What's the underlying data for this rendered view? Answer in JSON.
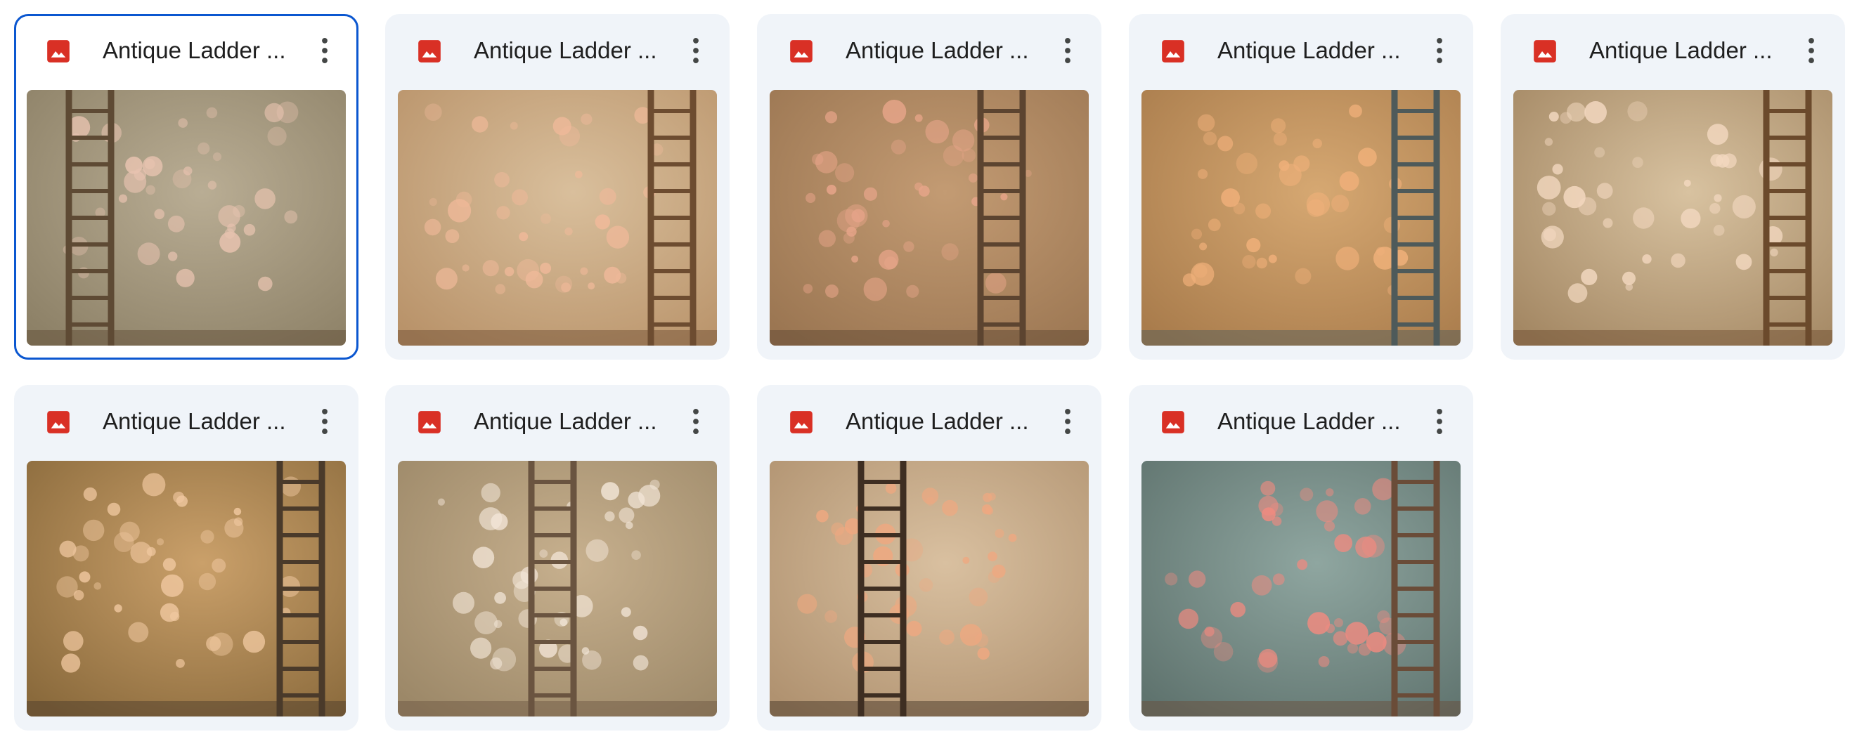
{
  "files": [
    {
      "name": "Antique Ladder ...",
      "selected": true,
      "palette": [
        "#b9ad94",
        "#8d8167",
        "#e8c3b0",
        "#5e4a34"
      ],
      "ladder": "left"
    },
    {
      "name": "Antique Ladder ...",
      "selected": false,
      "palette": [
        "#d9bf9c",
        "#b9936a",
        "#f0b99a",
        "#6d4c30"
      ],
      "ladder": "right"
    },
    {
      "name": "Antique Ladder ...",
      "selected": false,
      "palette": [
        "#c39b73",
        "#9b7652",
        "#e8a58a",
        "#5c4430"
      ],
      "ladder": "center"
    },
    {
      "name": "Antique Ladder ...",
      "selected": false,
      "palette": [
        "#d6a872",
        "#a97c4c",
        "#f0b07a",
        "#4e5a5a"
      ],
      "ladder": "right"
    },
    {
      "name": "Antique Ladder ...",
      "selected": false,
      "palette": [
        "#d8c2a0",
        "#a48864",
        "#f3d8c0",
        "#6b4a2c"
      ],
      "ladder": "right"
    },
    {
      "name": "Antique Ladder ...",
      "selected": false,
      "palette": [
        "#caa06a",
        "#8a6a3c",
        "#f0c8a0",
        "#4a3a2a"
      ],
      "ladder": "right"
    },
    {
      "name": "Antique Ladder ...",
      "selected": false,
      "palette": [
        "#c7b08e",
        "#9c8868",
        "#f3e6d8",
        "#6a5440"
      ],
      "ladder": "center"
    },
    {
      "name": "Antique Ladder ...",
      "selected": false,
      "palette": [
        "#d9c0a0",
        "#b09270",
        "#f0a880",
        "#3e2e22"
      ],
      "ladder": "center"
    },
    {
      "name": "Antique Ladder ...",
      "selected": false,
      "palette": [
        "#8fa6a0",
        "#5f736e",
        "#f08a80",
        "#6a4c38"
      ],
      "ladder": "right"
    }
  ],
  "icons": {
    "file_type": "image-file-icon",
    "more": "more-vert-icon"
  },
  "colors": {
    "card_bg": "#f0f4f9",
    "selected_border": "#0b57d0",
    "image_icon": "#d93025",
    "text": "#1f1f1f",
    "more_icon": "#444746"
  }
}
